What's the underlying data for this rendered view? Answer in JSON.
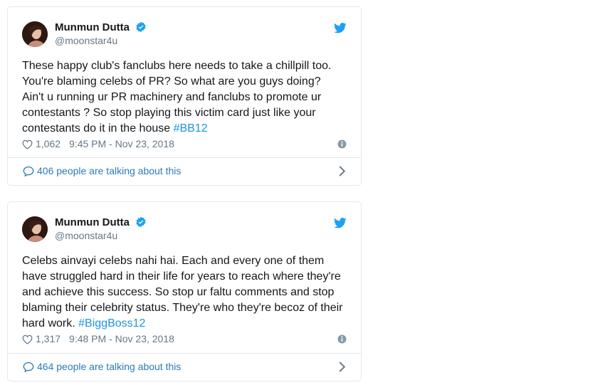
{
  "tweets": [
    {
      "name": "Munmun Dutta",
      "handle": "@moonstar4u",
      "text": "These happy club's fanclubs here needs to take a chillpill too.\nYou're  blaming celebs of PR? So what are you guys doing?\nAin't u running ur PR machinery and fanclubs to promote ur\ncontestants ? So stop playing this victim card just like your\ncontestants do it in the house ",
      "hashtag": "#BB12",
      "likes": "1,062",
      "timestamp": "9:45 PM - Nov 23, 2018",
      "talking": "406 people are talking about this"
    },
    {
      "name": "Munmun Dutta",
      "handle": "@moonstar4u",
      "text": "Celebs ainvayi celebs nahi hai. Each and every one of them\nhave struggled hard in their life for years to reach where they're\nand achieve this success. So stop ur faltu comments and stop\nblaming their celebrity status. They're who they're becoz of their\nhard work.  ",
      "hashtag": "#BiggBoss12",
      "likes": "1,317",
      "timestamp": "9:48 PM - Nov 23, 2018",
      "talking": "464 people are talking about this"
    }
  ],
  "colors": {
    "accent": "#1da1f2",
    "link": "#2b7bb9",
    "muted": "#657786",
    "border": "#e1e8ed"
  },
  "icons": [
    "verified-badge-icon",
    "twitter-bird-icon",
    "heart-icon",
    "info-icon",
    "reply-bubble-icon",
    "chevron-right-icon"
  ]
}
